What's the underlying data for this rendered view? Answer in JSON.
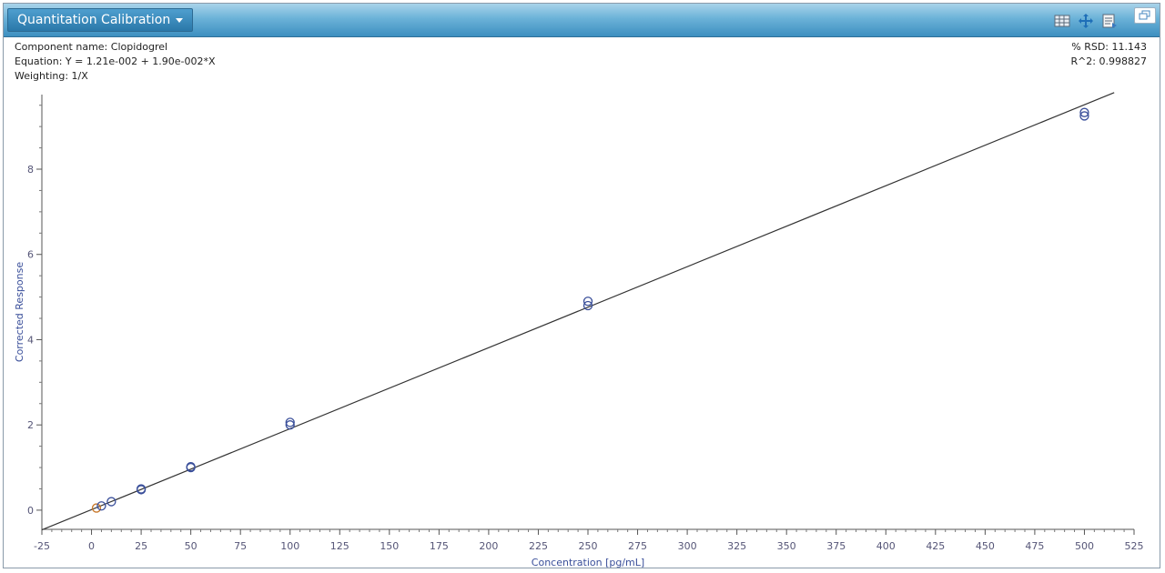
{
  "window": {
    "title": "Quantitation Calibration",
    "icons": [
      "table-icon",
      "move-icon",
      "export-icon",
      "restore-icon"
    ]
  },
  "info": {
    "component": "Component name: Clopidogrel",
    "equation": "Equation: Y = 1.21e-002 + 1.90e-002*X",
    "weighting": "Weighting: 1/X",
    "rsd": "% RSD: 11.143",
    "r2": "R^2: 0.998827"
  },
  "colors": {
    "titlebar": "#4a9cca",
    "point": "#3a4f9a",
    "highlight_point": "#c8782a",
    "line": "#333333",
    "axis_text": "#3a4f9a"
  },
  "chart_data": {
    "type": "scatter",
    "xlabel": "Concentration [pg/mL]",
    "ylabel": "Corrected Response",
    "xlim": [
      -25,
      525
    ],
    "ylim": [
      -0.45,
      9.75
    ],
    "xticks": [
      -25,
      0,
      25,
      50,
      75,
      100,
      125,
      150,
      175,
      200,
      225,
      250,
      275,
      300,
      325,
      350,
      375,
      400,
      425,
      450,
      475,
      500,
      525
    ],
    "yticks": [
      0,
      2,
      4,
      6,
      8
    ],
    "grid": false,
    "points": [
      {
        "x": 2.5,
        "y": 0.05,
        "highlight": true
      },
      {
        "x": 5,
        "y": 0.1
      },
      {
        "x": 10,
        "y": 0.2
      },
      {
        "x": 25,
        "y": 0.48
      },
      {
        "x": 25,
        "y": 0.5
      },
      {
        "x": 50,
        "y": 1.0
      },
      {
        "x": 50,
        "y": 1.02
      },
      {
        "x": 100,
        "y": 2.0
      },
      {
        "x": 100,
        "y": 2.06
      },
      {
        "x": 250,
        "y": 4.8
      },
      {
        "x": 250,
        "y": 4.9
      },
      {
        "x": 500,
        "y": 9.25
      },
      {
        "x": 500,
        "y": 9.33
      }
    ],
    "fit": {
      "intercept": 0.0121,
      "slope": 0.019
    }
  }
}
